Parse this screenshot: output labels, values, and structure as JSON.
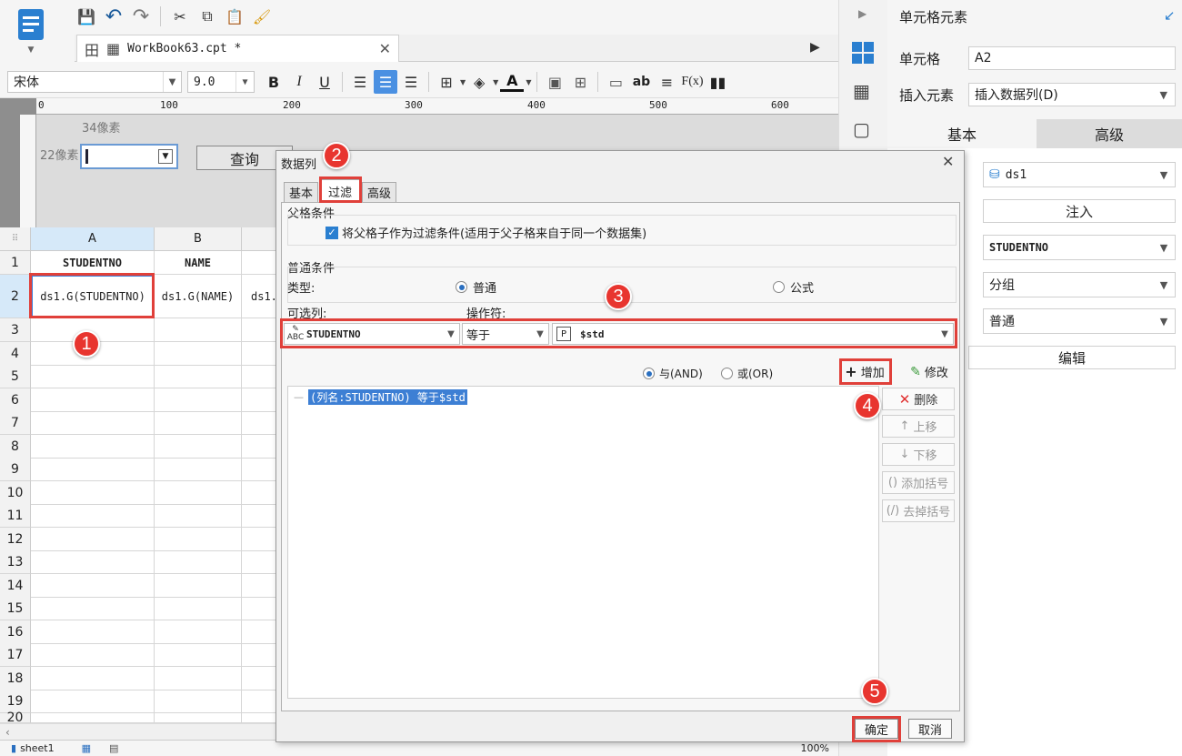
{
  "toolbar": {
    "font_name": "宋体",
    "font_size": "9.0",
    "icons": [
      "save-icon",
      "undo-icon",
      "redo-icon",
      "cut-icon",
      "copy-icon",
      "paste-icon",
      "format-brush-icon"
    ]
  },
  "tab": {
    "title": "WorkBook63.cpt *"
  },
  "ruler": {
    "ticks": [
      "0",
      "100",
      "200",
      "300",
      "400",
      "500",
      "600"
    ]
  },
  "form": {
    "label_34": "34像素",
    "label_22": "22像素",
    "query_button": "查询"
  },
  "sheet": {
    "columns": [
      "A",
      "B"
    ],
    "rows": [
      "1",
      "2",
      "3",
      "4",
      "5",
      "6",
      "7",
      "8",
      "9",
      "10",
      "11",
      "12",
      "13",
      "14",
      "15",
      "16",
      "17",
      "18",
      "19",
      "20"
    ],
    "cell_a1": "STUDENTNO",
    "cell_b1": "NAME",
    "cell_a2": "ds1.G(STUDENTNO)",
    "cell_b2": "ds1.G(NAME)",
    "cell_c2": "ds1.",
    "sheet_tab": "sheet1",
    "zoom": "100%"
  },
  "dialog": {
    "title": "数据列",
    "tabs": [
      "基本",
      "过滤",
      "高级"
    ],
    "parent_group": "父格条件",
    "parent_checkbox": "将父格子作为过滤条件(适用于父子格来自于同一个数据集)",
    "normal_group": "普通条件",
    "type_label": "类型:",
    "radio_normal": "普通",
    "radio_formula": "公式",
    "column_label": "可选列:",
    "operator_label": "操作符:",
    "column_value": "STUDENTNO",
    "operator_value": "等于",
    "param_value": "$std",
    "and_label": "与(AND)",
    "or_label": "或(OR)",
    "add_button": "增加",
    "modify_button": "修改",
    "delete_button": "删除",
    "up_button": "上移",
    "down_button": "下移",
    "add_bracket_button": "添加括号",
    "remove_bracket_button": "去掉括号",
    "condition_item": "(列名:STUDENTNO) 等于$std",
    "ok_button": "确定",
    "cancel_button": "取消"
  },
  "right_panel": {
    "title": "单元格元素",
    "cell_label": "单元格",
    "cell_value": "A2",
    "insert_label": "插入元素",
    "insert_value": "插入数据列(D)",
    "tab_basic": "基本",
    "tab_advanced": "高级",
    "dataset": "ds1",
    "inject_button": "注入",
    "field": "STUDENTNO",
    "group": "分组",
    "normal": "普通",
    "edit_button": "编辑"
  },
  "badges": [
    "1",
    "2",
    "3",
    "4",
    "5"
  ]
}
